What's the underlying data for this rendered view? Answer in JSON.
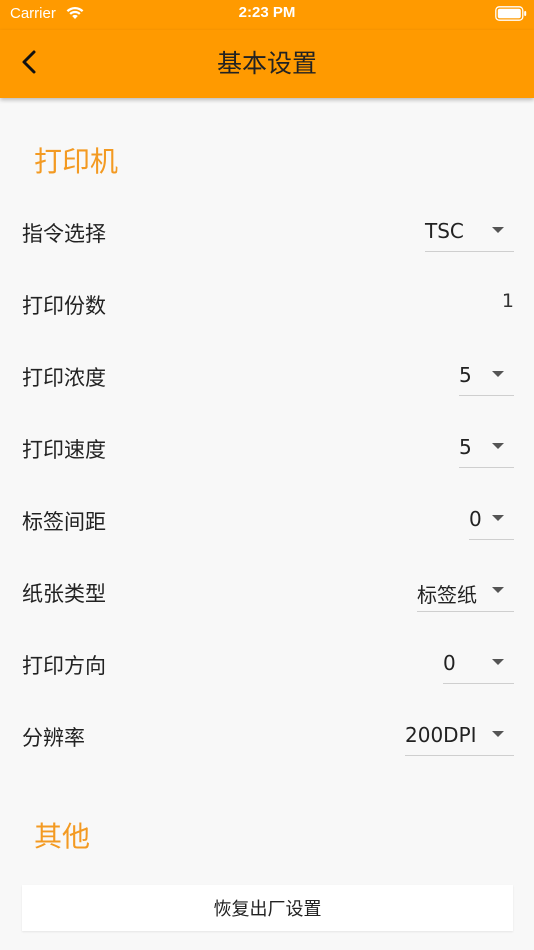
{
  "status_bar": {
    "carrier": "Carrier",
    "time": "2:23 PM",
    "wifi_icon": "wifi-icon",
    "battery_icon": "battery-icon"
  },
  "nav": {
    "title": "基本设置",
    "back_icon": "chevron-left-icon"
  },
  "colors": {
    "accent": "#ff9a00",
    "section_header": "#f39a22",
    "background": "#f8f8f8"
  },
  "sections": {
    "printer": {
      "header": "打印机",
      "rows": [
        {
          "label": "指令选择",
          "value": "TSC",
          "type": "dropdown"
        },
        {
          "label": "打印份数",
          "value": "1",
          "type": "text"
        },
        {
          "label": "打印浓度",
          "value": "5",
          "type": "dropdown"
        },
        {
          "label": "打印速度",
          "value": "5",
          "type": "dropdown"
        },
        {
          "label": "标签间距",
          "value": "0",
          "type": "dropdown"
        },
        {
          "label": "纸张类型",
          "value": "标签纸",
          "type": "dropdown"
        },
        {
          "label": "打印方向",
          "value": "0",
          "type": "dropdown"
        },
        {
          "label": "分辨率",
          "value": "200DPI",
          "type": "dropdown"
        }
      ]
    },
    "other": {
      "header": "其他",
      "reset_button_label": "恢复出厂设置"
    }
  }
}
